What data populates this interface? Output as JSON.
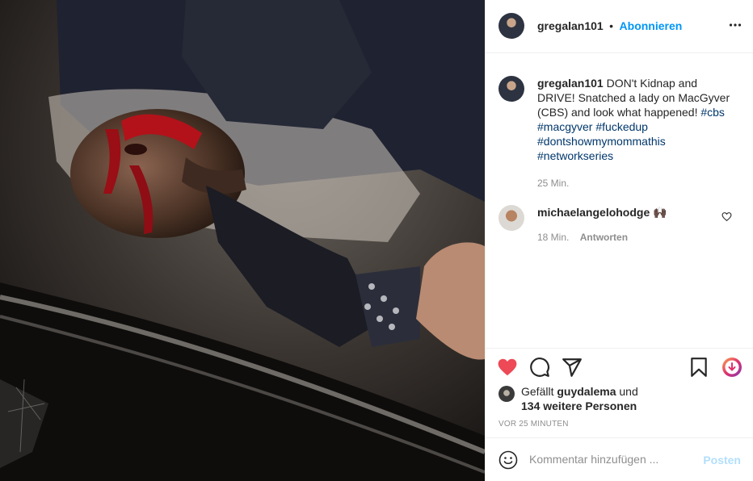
{
  "post": {
    "image_alt": "Photo",
    "owner": {
      "username": "gregalan101",
      "separator": "•",
      "follow_label": "Abonnieren"
    },
    "more_icon": "more-horizontal-icon",
    "caption": {
      "username": "gregalan101",
      "text": "DON't Kidnap and DRIVE! Snatched a lady on MacGyver (CBS) and look what happened!",
      "hashtags": [
        "#cbs",
        "#macgyver",
        "#fuckedup",
        "#dontshowmymommathis",
        "#networkseries"
      ],
      "time": "25 Min."
    },
    "comment": {
      "username": "michaelangelohodge",
      "emoji": "🙌🏿",
      "time": "18 Min.",
      "reply_label": "Antworten"
    },
    "actions": {
      "like_icon": "heart-filled-icon",
      "comment_icon": "comment-bubble-icon",
      "share_icon": "paper-plane-icon",
      "save_icon": "bookmark-icon",
      "download_icon": "download-circle-icon",
      "like_color": "#ed4956"
    },
    "likes": {
      "prefix": "Gefällt",
      "user": "guydalema",
      "connector": "und",
      "others": "134 weitere Personen"
    },
    "timestamp": "VOR 25 MINUTEN",
    "add_comment": {
      "placeholder": "Kommentar hinzufügen ...",
      "post_label": "Posten"
    }
  }
}
